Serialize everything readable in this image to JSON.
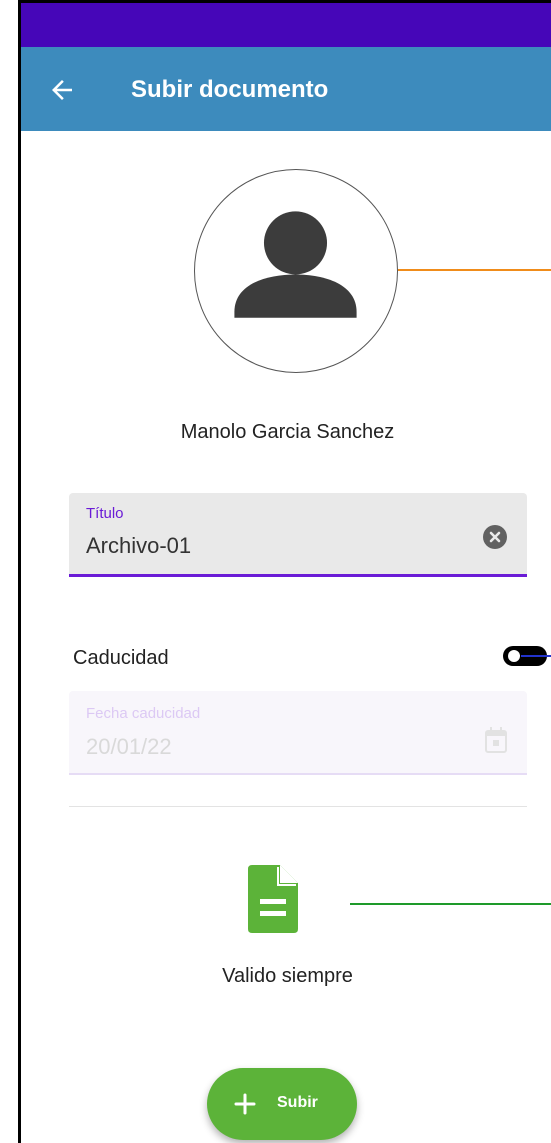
{
  "app_bar": {
    "title": "Subir documento",
    "back_icon": "arrow-left-icon"
  },
  "profile": {
    "name": "Manolo Garcia Sanchez",
    "avatar_icon": "person-icon"
  },
  "form": {
    "title_field": {
      "label": "Título",
      "value": "Archivo-01",
      "clear_icon": "clear-circle-icon"
    },
    "expiry": {
      "label": "Caducidad",
      "enabled": false
    },
    "expiry_date_field": {
      "label": "Fecha caducidad",
      "value": "20/01/22",
      "icon": "calendar-icon",
      "disabled": true
    }
  },
  "document": {
    "icon": "document-icon",
    "caption": "Valido siempre"
  },
  "upload_button": {
    "label": "Subir",
    "icon": "plus-icon"
  },
  "colors": {
    "status_bar": "#4606b8",
    "app_bar": "#3d8bbd",
    "accent": "#6a1bd6",
    "green": "#5cb339",
    "orange_connector": "#f08c1a",
    "blue_connector": "#2233cc",
    "green_connector": "#1e9a2a"
  }
}
